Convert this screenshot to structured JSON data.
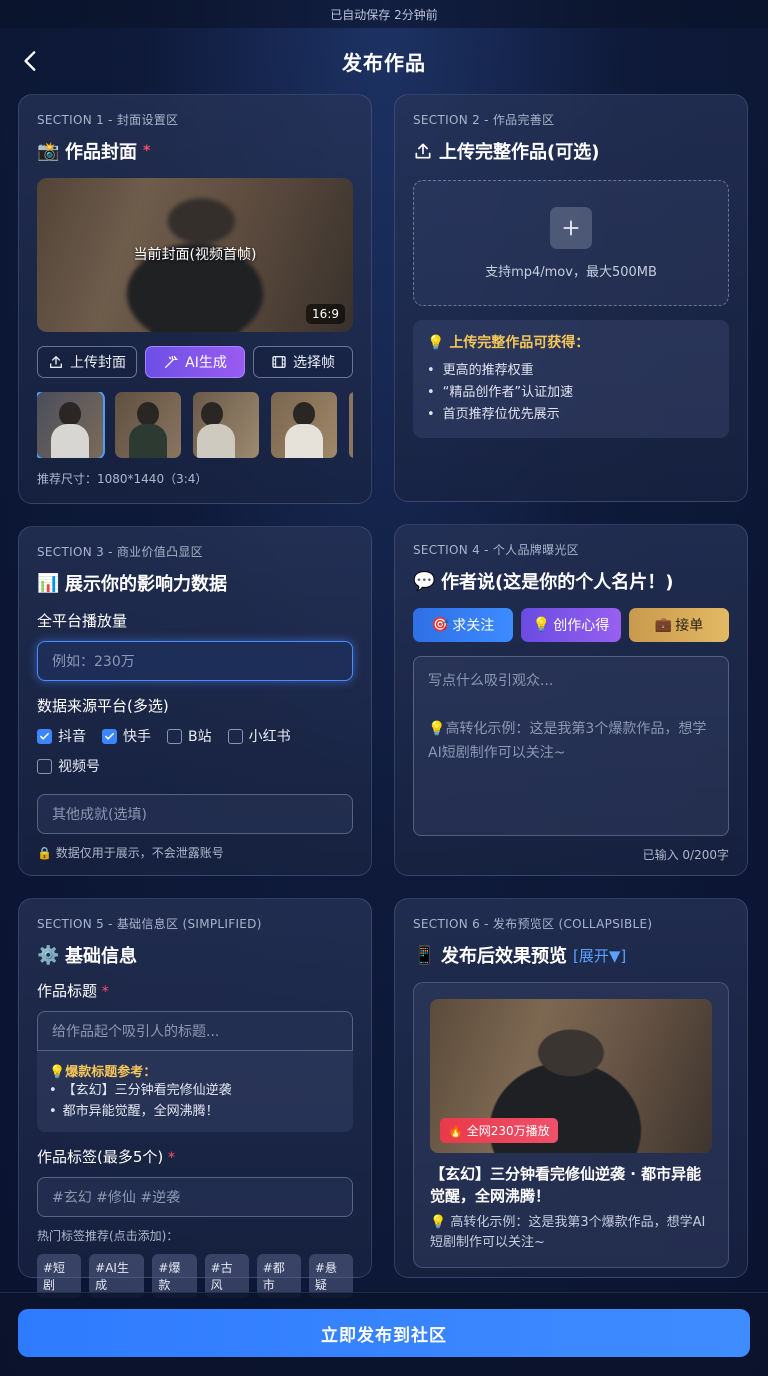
{
  "status_bar": {
    "autosave": "已自动保存 2分钟前"
  },
  "nav": {
    "title": "发布作品"
  },
  "section1": {
    "label": "SECTION 1 - 封面设置区",
    "title": "作品封面",
    "required": "*",
    "cover_caption": "当前封面(视频首帧)",
    "ratio": "16:9",
    "buttons": {
      "upload": "上传封面",
      "ai": "AI生成",
      "frame": "选择帧"
    },
    "size_hint": "推荐尺寸：1080*1440（3:4）"
  },
  "section2": {
    "label": "SECTION 2 - 作品完善区",
    "title": "上传完整作品(可选)",
    "upload_hint": "支持mp4/mov，最大500MB",
    "benefits_title": "上传完整作品可获得：",
    "benefits": [
      "更高的推荐权重",
      "“精品创作者”认证加速",
      "首页推荐位优先展示"
    ]
  },
  "section3": {
    "label": "SECTION 3 - 商业价值凸显区",
    "title": "展示你的影响力数据",
    "plays_label": "全平台播放量",
    "plays_placeholder": "例如：230万",
    "platforms_label": "数据来源平台(多选)",
    "platforms": [
      {
        "name": "抖音",
        "checked": true
      },
      {
        "name": "快手",
        "checked": true
      },
      {
        "name": "B站",
        "checked": false
      },
      {
        "name": "小红书",
        "checked": false
      },
      {
        "name": "视频号",
        "checked": false
      }
    ],
    "other_placeholder": "其他成就(选填)",
    "privacy": "数据仅用于展示，不会泄露账号"
  },
  "section4": {
    "label": "SECTION 4 - 个人品牌曝光区",
    "title": "作者说(这是你的个人名片！)",
    "pills": {
      "follow": "求关注",
      "insight": "创作心得",
      "order": "接单"
    },
    "placeholder_line1": "写点什么吸引观众...",
    "placeholder_line2": "高转化示例：这是我第3个爆款作品，想学AI短剧制作可以关注~",
    "counter": "已输入 0/200字"
  },
  "section5": {
    "label": "SECTION 5 - 基础信息区 (SIMPLIFIED)",
    "title": "基础信息",
    "title_label": "作品标题",
    "title_placeholder": "给作品起个吸引人的标题...",
    "ref_title": "爆款标题参考：",
    "refs": [
      "【玄幻】三分钟看完修仙逆袭",
      "都市异能觉醒，全网沸腾！"
    ],
    "tags_label": "作品标签(最多5个)",
    "tags_placeholder": "#玄幻 #修仙 #逆袭",
    "hot_label": "热门标签推荐(点击添加)：",
    "hot_tags": [
      "#短剧",
      "#AI生成",
      "#爆款",
      "#古风",
      "#都市",
      "#悬疑"
    ]
  },
  "section6": {
    "label": "SECTION 6 - 发布预览区 (COLLAPSIBLE)",
    "title": "发布后效果预览",
    "expand": "[展开▼]",
    "badge": "全网230万播放",
    "preview_title": "【玄幻】三分钟看完修仙逆袭 · 都市异能觉醒，全网沸腾！",
    "preview_desc": "高转化示例：这是我第3个爆款作品，想学AI短剧制作可以关注~"
  },
  "footer": {
    "publish": "立即发布到社区"
  },
  "colors": {
    "accent": "#3b86ff",
    "gold": "#f5c65a",
    "required": "#ff4d6a"
  }
}
